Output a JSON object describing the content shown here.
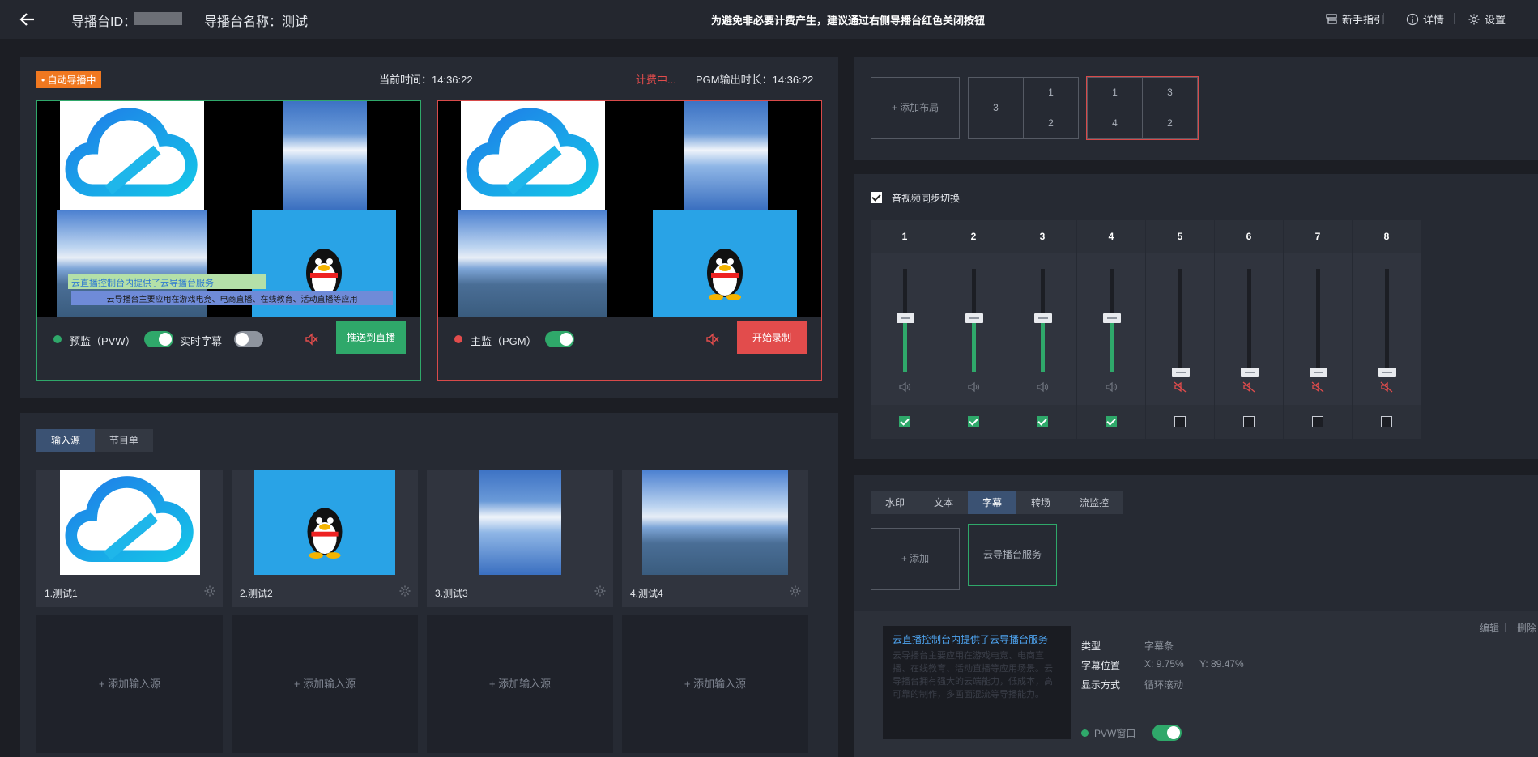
{
  "header": {
    "id_label": "导播台ID：",
    "name_label": "导播台名称：测试",
    "notice": "为避免非必要计费产生，建议通过右侧导播台红色关闭按钮",
    "guide": "新手指引",
    "detail": "详情",
    "settings": "设置"
  },
  "monitor": {
    "auto_badge": "• 自动导播中",
    "current_time": "当前时间：14:36:22",
    "billing": "计费中...",
    "pgm_duration": "PGM输出时长：14:36:22",
    "subtitle_line1": "云直播控制台内提供了云导播台服务",
    "subtitle_line2": "云导播台主要应用在游戏电竞、电商直播、在线教育、活动直播等应用",
    "pvw": {
      "label": "预监（PVW）",
      "realtime_label": "实时字幕",
      "push_button": "推送到直播",
      "pvw_toggle_on": true,
      "realtime_toggle_on": false
    },
    "pgm": {
      "label": "主监（PGM）",
      "record_button": "开始录制",
      "toggle_on": true
    }
  },
  "sources": {
    "tabs": [
      "输入源",
      "节目单"
    ],
    "active_tab": 0,
    "items": [
      {
        "caption": "1.测试1",
        "kind": "cloud-logo"
      },
      {
        "caption": "2.测试2",
        "kind": "qq"
      },
      {
        "caption": "3.测试3",
        "kind": "sky"
      },
      {
        "caption": "4.测试4",
        "kind": "sea"
      }
    ],
    "add_label": "+ 添加输入源"
  },
  "layouts": {
    "add_label": "+ 添加布局",
    "layout_a": [
      "3",
      "1",
      "2"
    ],
    "layout_b": [
      "1",
      "3",
      "4",
      "2"
    ]
  },
  "audio": {
    "sync_label": "音视频同步切换",
    "sync_checked": true,
    "channels": [
      {
        "num": "1",
        "level": 0.52,
        "muted": false,
        "checked": true
      },
      {
        "num": "2",
        "level": 0.52,
        "muted": false,
        "checked": true
      },
      {
        "num": "3",
        "level": 0.52,
        "muted": false,
        "checked": true
      },
      {
        "num": "4",
        "level": 0.52,
        "muted": false,
        "checked": true
      },
      {
        "num": "5",
        "level": 0.0,
        "muted": true,
        "checked": false
      },
      {
        "num": "6",
        "level": 0.0,
        "muted": true,
        "checked": false
      },
      {
        "num": "7",
        "level": 0.0,
        "muted": true,
        "checked": false
      },
      {
        "num": "8",
        "level": 0.0,
        "muted": true,
        "checked": false
      }
    ]
  },
  "effects": {
    "tabs": [
      "水印",
      "文本",
      "字幕",
      "转场",
      "流监控"
    ],
    "active_tab": 2,
    "add_label": "+ 添加",
    "item_label": "云导播台服务",
    "edit_label": "编辑",
    "delete_label": "删除",
    "preview_title": "云直播控制台内提供了云导播台服务",
    "preview_body": "云导播台主要应用在游戏电竞、电商直播、在线教育、活动直播等应用场景。云导播台拥有强大的云端能力，低成本，高可靠的制作，多画面混流等导播能力。",
    "type_key": "类型",
    "type_val": "字幕条",
    "pos_key": "字幕位置",
    "pos_x": "X: 9.75%",
    "pos_y": "Y: 89.47%",
    "display_key": "显示方式",
    "display_val": "循环滚动",
    "pvw_window": "PVW窗口",
    "pvw_window_on": true
  },
  "colors": {
    "accent_green": "#2fa86a",
    "accent_red": "#e24c4c",
    "badge_orange": "#f07820",
    "active_tab": "#3b5273"
  }
}
